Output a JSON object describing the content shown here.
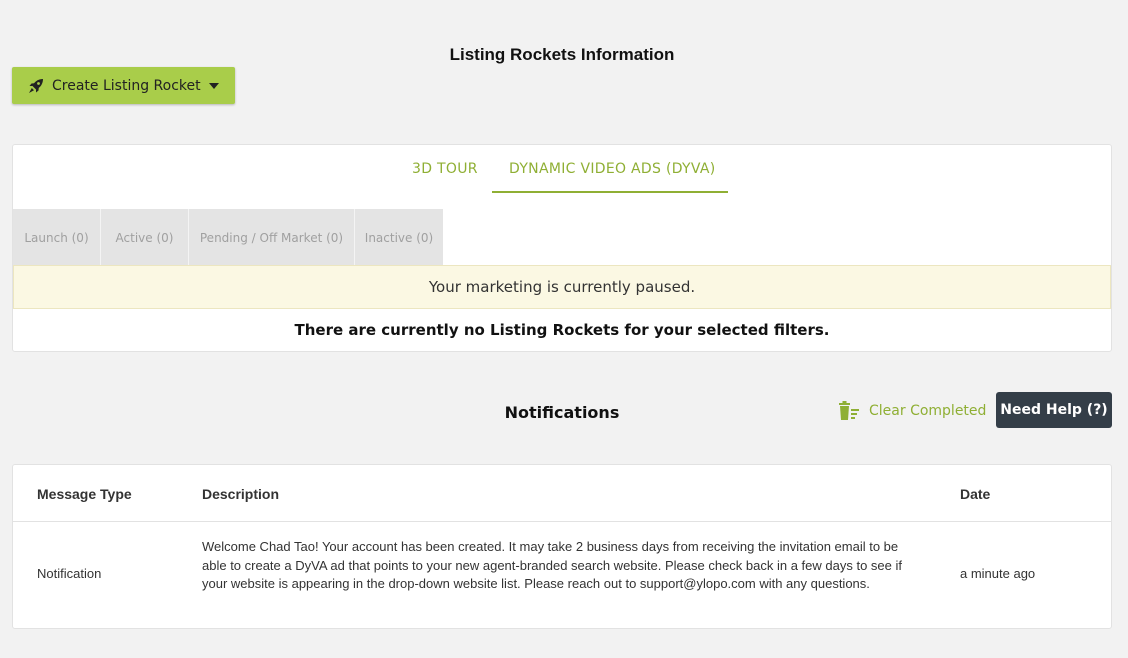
{
  "header": {
    "title": "Listing Rockets Information",
    "create_button_label": "Create Listing Rocket"
  },
  "tabs": [
    {
      "label": "3D TOUR",
      "active": false
    },
    {
      "label": "DYNAMIC VIDEO ADS (DYVA)",
      "active": true
    }
  ],
  "filters": [
    {
      "label": "Launch (0)"
    },
    {
      "label": "Active (0)"
    },
    {
      "label": "Pending / Off Market (0)"
    },
    {
      "label": "Inactive (0)"
    }
  ],
  "status": {
    "paused_message": "Your marketing is currently paused.",
    "empty_message": "There are currently no Listing Rockets for your selected filters."
  },
  "notifications": {
    "title": "Notifications",
    "clear_label": "Clear Completed",
    "help_label": "Need Help (?)",
    "columns": [
      "Message Type",
      "Description",
      "Date"
    ],
    "rows": [
      {
        "type": "Notification",
        "description": "Welcome Chad Tao! Your account has been created. It may take 2 business days from receiving the invitation email to be able to create a DyVA ad that points to your new agent-branded search website. Please check back in a few days to see if your website is appearing in the drop-down website list. Please reach out to support@ylopo.com with any questions.",
        "date": "a minute ago"
      }
    ]
  },
  "colors": {
    "accent_green": "#8faf34",
    "button_green": "#a9cd4a",
    "help_dark": "#343e48",
    "paused_bg": "#fbf8e3"
  },
  "icons": {
    "create_button": "rocket-icon",
    "create_dropdown": "caret-down-icon",
    "clear_completed": "trash-list-icon"
  }
}
